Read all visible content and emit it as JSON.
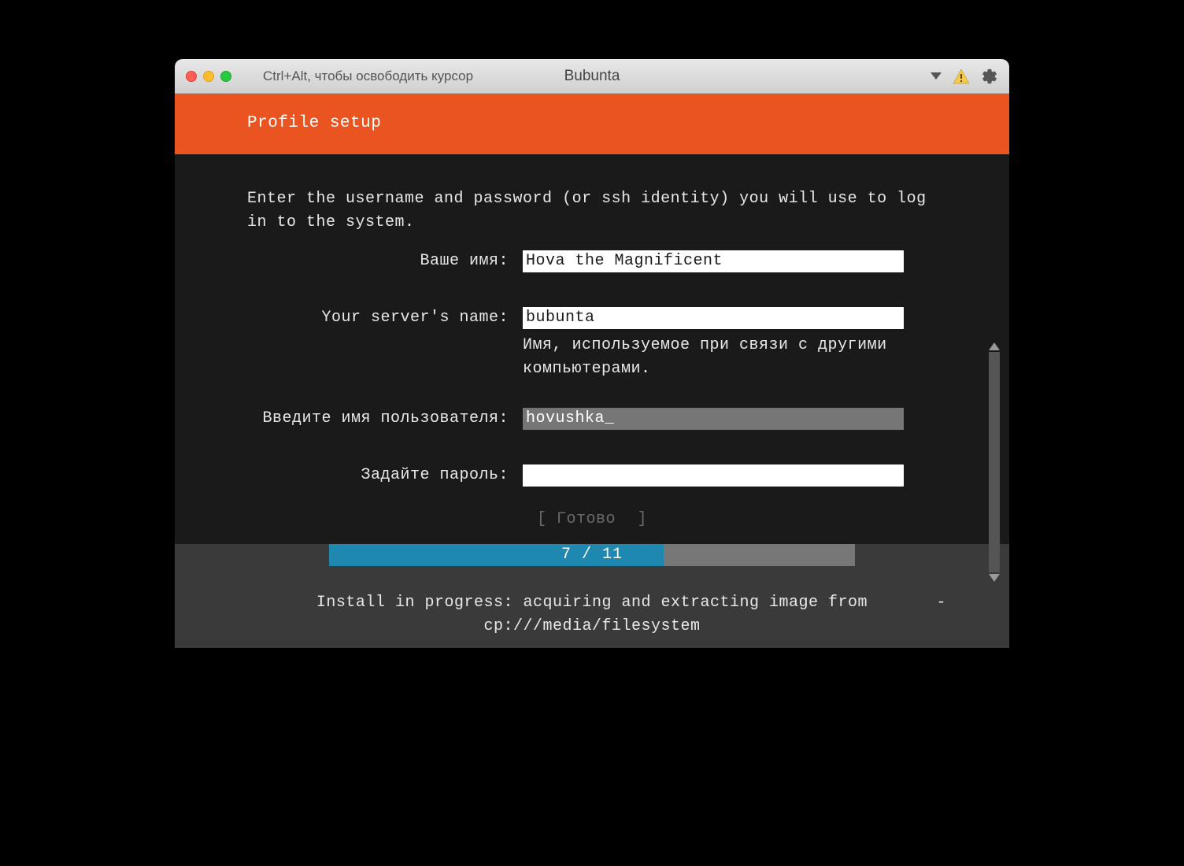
{
  "titlebar": {
    "hint": "Ctrl+Alt, чтобы освободить курсор",
    "vm_name": "Bubunta"
  },
  "installer": {
    "header_title": "Profile setup",
    "instruction": "Enter the username and password (or ssh identity) you will use to log in to the system.",
    "fields": {
      "your_name": {
        "label": "Ваше имя:",
        "value": "Hova the Magnificent"
      },
      "server_name": {
        "label": "Your server's name:",
        "value": "bubunta",
        "helper": "Имя, используемое при связи с другими компьютерами."
      },
      "username": {
        "label": "Введите имя пользователя:",
        "value": "hovushka"
      },
      "password": {
        "label": "Задайте пароль:",
        "value": ""
      }
    },
    "done_label": "Готово",
    "progress": {
      "current": 7,
      "total": 11,
      "display": "7 / 11",
      "percent": 63.6
    },
    "status_prefix": "Install in progress:",
    "status_msg": "acquiring and extracting image from cp:///media/filesystem",
    "spinner": "-"
  },
  "colors": {
    "orange": "#e95420",
    "progress": "#1e88b0"
  }
}
